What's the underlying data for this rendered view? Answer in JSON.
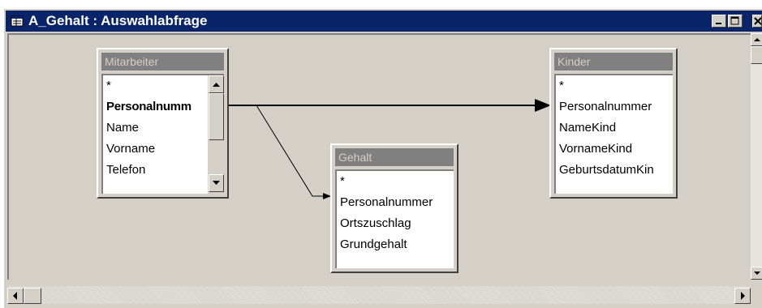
{
  "window": {
    "title": "A_Gehalt : Auswahlabfrage",
    "titlebar_color": "#0a246a",
    "buttons": [
      "minimize-icon",
      "maximize-icon",
      "close-icon"
    ]
  },
  "tables": [
    {
      "name": "Mitarbeiter",
      "fields": [
        "*",
        "Personalnumm",
        "Name",
        "Vorname",
        "Telefon"
      ],
      "primary_key": "Personalnumm",
      "has_scrollbar": true
    },
    {
      "name": "Gehalt",
      "fields": [
        "*",
        "Personalnummer",
        "Ortszuschlag",
        "Grundgehalt"
      ],
      "has_scrollbar": false
    },
    {
      "name": "Kinder",
      "fields": [
        "*",
        "Personalnummer",
        "NameKind",
        "VornameKind",
        "GeburtsdatumKin"
      ],
      "has_scrollbar": false
    }
  ],
  "relationships": [
    {
      "from": "Mitarbeiter.Personalnumm",
      "to": "Kinder.Personalnummer",
      "type": "arrow"
    },
    {
      "from": "Mitarbeiter.Personalnumm",
      "to": "Gehalt.Personalnummer",
      "type": "arrow"
    }
  ]
}
